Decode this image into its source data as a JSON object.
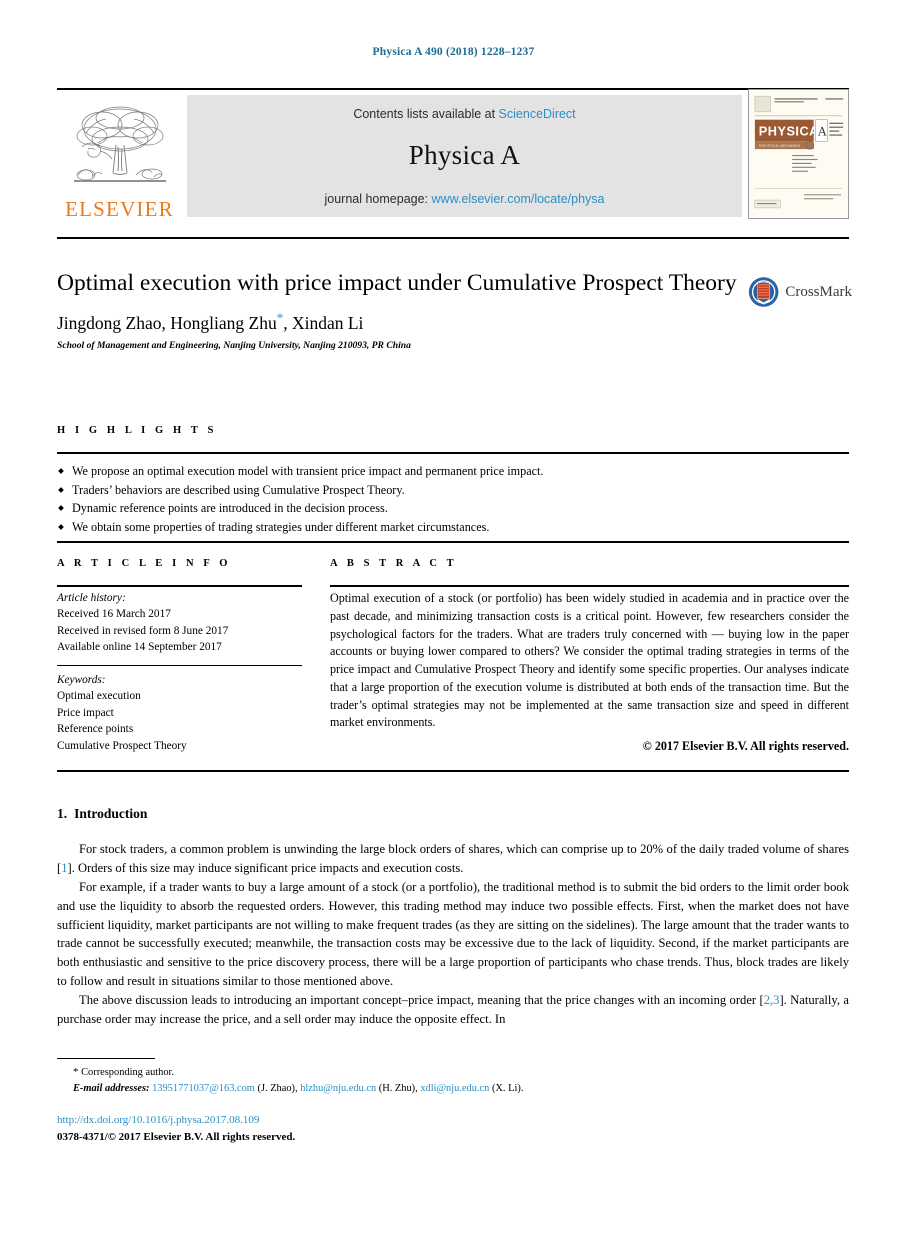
{
  "running_head": "Physica A 490 (2018) 1228–1237",
  "masthead": {
    "publisher_name": "ELSEVIER",
    "contents_prefix": "Contents lists available at ",
    "contents_link": "ScienceDirect",
    "journal_title": "Physica A",
    "homepage_prefix": "journal homepage: ",
    "homepage_link": "www.elsevier.com/locate/physa",
    "cover": {
      "banner": "PHYSICA",
      "banner_letter": "A",
      "subtitle_line1": "STATISTICAL MECHANICS",
      "subtitle_line2": "AND ITS APPLICATIONS"
    }
  },
  "article": {
    "title": "Optimal execution with price impact under Cumulative Prospect Theory",
    "authors_prefix": "Jingdong Zhao, Hongliang Zhu",
    "authors_suffix": ", Xindan Li",
    "corresponding_marker": "*",
    "affiliation": "School of Management and Engineering, Nanjing University, Nanjing 210093, PR China",
    "crossmark_label": "CrossMark"
  },
  "highlights": {
    "label": "H I G H L I G H T S",
    "items": [
      "We propose an optimal execution model with transient price impact and permanent price impact.",
      "Traders’ behaviors are described using Cumulative Prospect Theory.",
      "Dynamic reference points are introduced in the decision process.",
      "We obtain some properties of trading strategies under different market circumstances."
    ]
  },
  "article_info": {
    "label": "A R T I C L E    I N F O",
    "history_label": "Article history:",
    "history": [
      "Received 16 March 2017",
      "Received in revised form 8 June 2017",
      "Available online 14 September 2017"
    ],
    "keywords_label": "Keywords:",
    "keywords": [
      "Optimal execution",
      "Price impact",
      "Reference points",
      "Cumulative Prospect Theory"
    ]
  },
  "abstract": {
    "label": "A B S T R A C T",
    "text": "Optimal execution of a stock (or portfolio) has been widely studied in academia and in practice over the past decade, and minimizing transaction costs is a critical point. However, few researchers consider the psychological factors for the traders. What are traders truly concerned with — buying low in the paper accounts or buying lower compared to others? We consider the optimal trading strategies in terms of the price impact and Cumulative Prospect Theory and identify some specific properties. Our analyses indicate that a large proportion of the execution volume is distributed at both ends of the transaction time. But the trader’s optimal strategies may not be implemented at the same transaction size and speed in different market environments.",
    "copyright": "© 2017 Elsevier B.V. All rights reserved."
  },
  "body": {
    "section_number": "1.",
    "section_title": "Introduction",
    "paragraph1_a": "For stock traders, a common problem is unwinding the large block orders of shares, which can comprise up to 20% of the daily traded volume of shares [",
    "paragraph1_cite": "1",
    "paragraph1_b": "]. Orders of this size may induce significant price impacts and execution costs.",
    "paragraph2": "For example, if a trader wants to buy a large amount of a stock (or a portfolio), the traditional method is to submit the bid orders to the limit order book and use the liquidity to absorb the requested orders. However, this trading method may induce two possible effects. First, when the market does not have sufficient liquidity, market participants are not willing to make frequent trades (as they are sitting on the sidelines). The large amount that the trader wants to trade cannot be successfully executed; meanwhile, the transaction costs may be excessive due to the lack of liquidity. Second, if the market participants are both enthusiastic and sensitive to the price discovery process, there will be a large proportion of participants who chase trends. Thus, block trades are likely to follow and result in situations similar to those mentioned above.",
    "paragraph3_a": "The above discussion leads to introducing an important concept–price impact, meaning that the price changes with an incoming order [",
    "paragraph3_cite": "2,3",
    "paragraph3_b": "]. Naturally, a purchase order may increase the price, and a sell order may induce the opposite effect. In"
  },
  "footer": {
    "corresponding_star": "*",
    "corresponding_text": "Corresponding author.",
    "email_label": "E-mail addresses:",
    "emails": [
      {
        "address": "13951771037@163.com",
        "owner": "(J. Zhao)"
      },
      {
        "address": "hlzhu@nju.edu.cn",
        "owner": "(H. Zhu)"
      },
      {
        "address": "xdli@nju.edu.cn",
        "owner": "(X. Li)"
      }
    ],
    "doi": "http://dx.doi.org/10.1016/j.physa.2017.08.109",
    "issn_line": "0378-4371/© 2017 Elsevier B.V. All rights reserved."
  },
  "colors": {
    "link_blue": "#2a8fc4",
    "elsevier_orange": "#e87b1e",
    "running_head_blue": "#1a6a94",
    "band_gray": "#e3e3e3"
  }
}
